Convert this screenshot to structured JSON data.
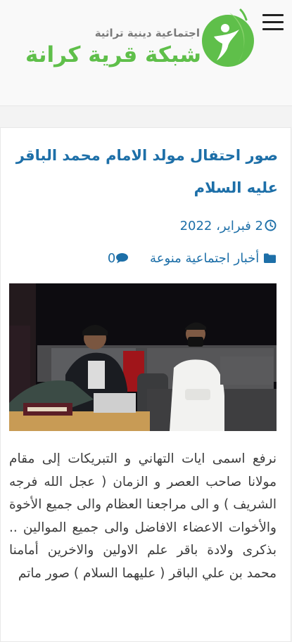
{
  "header": {
    "site_name": "شبكة قرية كرانة",
    "tagline": "اجتماعية دينية تراثية",
    "menu_icon": "hamburger-icon",
    "brand_color": "#5fbf4a"
  },
  "post": {
    "title": "صور احتفال مولد الامام محمد الباقر عليه السلام",
    "date": "2 فبراير، 2022",
    "category": "أخبار اجتماعية منوعة",
    "comments_count": "0",
    "link_color": "#1d6fa8",
    "body": "نرفع اسمى ايات التهاني و التبريكات إلى مقام مولانا صاحب العصر و الزمان ( عجل الله فرجه الشريف ) و الى مراجعنا العظام والى جميع الأخوة والأخوات الاعضاء الافاضل والى جميع الموالين .. بذكرى ولادة باقر علم الاولين والاخرين أمامنا محمد بن علي الباقر ( عليهما السلام ) صور ماتم"
  }
}
